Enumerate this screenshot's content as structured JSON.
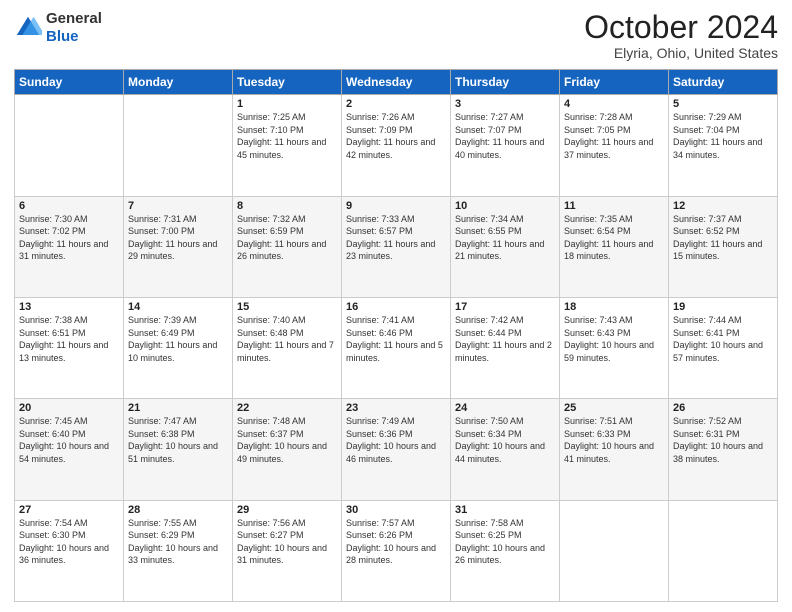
{
  "header": {
    "logo_line1": "General",
    "logo_line2": "Blue",
    "month": "October 2024",
    "location": "Elyria, Ohio, United States"
  },
  "days_of_week": [
    "Sunday",
    "Monday",
    "Tuesday",
    "Wednesday",
    "Thursday",
    "Friday",
    "Saturday"
  ],
  "weeks": [
    [
      null,
      null,
      {
        "day": "1",
        "sunrise": "7:25 AM",
        "sunset": "7:10 PM",
        "daylight": "11 hours and 45 minutes."
      },
      {
        "day": "2",
        "sunrise": "7:26 AM",
        "sunset": "7:09 PM",
        "daylight": "11 hours and 42 minutes."
      },
      {
        "day": "3",
        "sunrise": "7:27 AM",
        "sunset": "7:07 PM",
        "daylight": "11 hours and 40 minutes."
      },
      {
        "day": "4",
        "sunrise": "7:28 AM",
        "sunset": "7:05 PM",
        "daylight": "11 hours and 37 minutes."
      },
      {
        "day": "5",
        "sunrise": "7:29 AM",
        "sunset": "7:04 PM",
        "daylight": "11 hours and 34 minutes."
      }
    ],
    [
      {
        "day": "6",
        "sunrise": "7:30 AM",
        "sunset": "7:02 PM",
        "daylight": "11 hours and 31 minutes."
      },
      {
        "day": "7",
        "sunrise": "7:31 AM",
        "sunset": "7:00 PM",
        "daylight": "11 hours and 29 minutes."
      },
      {
        "day": "8",
        "sunrise": "7:32 AM",
        "sunset": "6:59 PM",
        "daylight": "11 hours and 26 minutes."
      },
      {
        "day": "9",
        "sunrise": "7:33 AM",
        "sunset": "6:57 PM",
        "daylight": "11 hours and 23 minutes."
      },
      {
        "day": "10",
        "sunrise": "7:34 AM",
        "sunset": "6:55 PM",
        "daylight": "11 hours and 21 minutes."
      },
      {
        "day": "11",
        "sunrise": "7:35 AM",
        "sunset": "6:54 PM",
        "daylight": "11 hours and 18 minutes."
      },
      {
        "day": "12",
        "sunrise": "7:37 AM",
        "sunset": "6:52 PM",
        "daylight": "11 hours and 15 minutes."
      }
    ],
    [
      {
        "day": "13",
        "sunrise": "7:38 AM",
        "sunset": "6:51 PM",
        "daylight": "11 hours and 13 minutes."
      },
      {
        "day": "14",
        "sunrise": "7:39 AM",
        "sunset": "6:49 PM",
        "daylight": "11 hours and 10 minutes."
      },
      {
        "day": "15",
        "sunrise": "7:40 AM",
        "sunset": "6:48 PM",
        "daylight": "11 hours and 7 minutes."
      },
      {
        "day": "16",
        "sunrise": "7:41 AM",
        "sunset": "6:46 PM",
        "daylight": "11 hours and 5 minutes."
      },
      {
        "day": "17",
        "sunrise": "7:42 AM",
        "sunset": "6:44 PM",
        "daylight": "11 hours and 2 minutes."
      },
      {
        "day": "18",
        "sunrise": "7:43 AM",
        "sunset": "6:43 PM",
        "daylight": "10 hours and 59 minutes."
      },
      {
        "day": "19",
        "sunrise": "7:44 AM",
        "sunset": "6:41 PM",
        "daylight": "10 hours and 57 minutes."
      }
    ],
    [
      {
        "day": "20",
        "sunrise": "7:45 AM",
        "sunset": "6:40 PM",
        "daylight": "10 hours and 54 minutes."
      },
      {
        "day": "21",
        "sunrise": "7:47 AM",
        "sunset": "6:38 PM",
        "daylight": "10 hours and 51 minutes."
      },
      {
        "day": "22",
        "sunrise": "7:48 AM",
        "sunset": "6:37 PM",
        "daylight": "10 hours and 49 minutes."
      },
      {
        "day": "23",
        "sunrise": "7:49 AM",
        "sunset": "6:36 PM",
        "daylight": "10 hours and 46 minutes."
      },
      {
        "day": "24",
        "sunrise": "7:50 AM",
        "sunset": "6:34 PM",
        "daylight": "10 hours and 44 minutes."
      },
      {
        "day": "25",
        "sunrise": "7:51 AM",
        "sunset": "6:33 PM",
        "daylight": "10 hours and 41 minutes."
      },
      {
        "day": "26",
        "sunrise": "7:52 AM",
        "sunset": "6:31 PM",
        "daylight": "10 hours and 38 minutes."
      }
    ],
    [
      {
        "day": "27",
        "sunrise": "7:54 AM",
        "sunset": "6:30 PM",
        "daylight": "10 hours and 36 minutes."
      },
      {
        "day": "28",
        "sunrise": "7:55 AM",
        "sunset": "6:29 PM",
        "daylight": "10 hours and 33 minutes."
      },
      {
        "day": "29",
        "sunrise": "7:56 AM",
        "sunset": "6:27 PM",
        "daylight": "10 hours and 31 minutes."
      },
      {
        "day": "30",
        "sunrise": "7:57 AM",
        "sunset": "6:26 PM",
        "daylight": "10 hours and 28 minutes."
      },
      {
        "day": "31",
        "sunrise": "7:58 AM",
        "sunset": "6:25 PM",
        "daylight": "10 hours and 26 minutes."
      },
      null,
      null
    ]
  ]
}
